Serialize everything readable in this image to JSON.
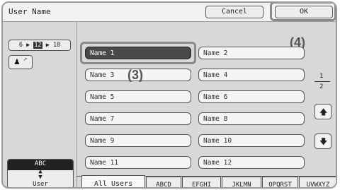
{
  "title": "User Name",
  "buttons": {
    "cancel": "Cancel",
    "ok": "OK"
  },
  "callouts": {
    "c3": "(3)",
    "c4": "(4)"
  },
  "page_range": {
    "prev": "6",
    "current": "12",
    "next": "18"
  },
  "names": [
    "Name 1",
    "Name 2",
    "Name 3",
    "Name 4",
    "Name 5",
    "Name 6",
    "Name 7",
    "Name 8",
    "Name 9",
    "Name 10",
    "Name 11",
    "Name 12"
  ],
  "pager": {
    "current": "1",
    "total": "2"
  },
  "sort": {
    "top": "ABC",
    "bottom": "User"
  },
  "tabs": [
    "All Users",
    "ABCD",
    "EFGHI",
    "JKLMN",
    "OPQRST",
    "UVWXYZ"
  ]
}
